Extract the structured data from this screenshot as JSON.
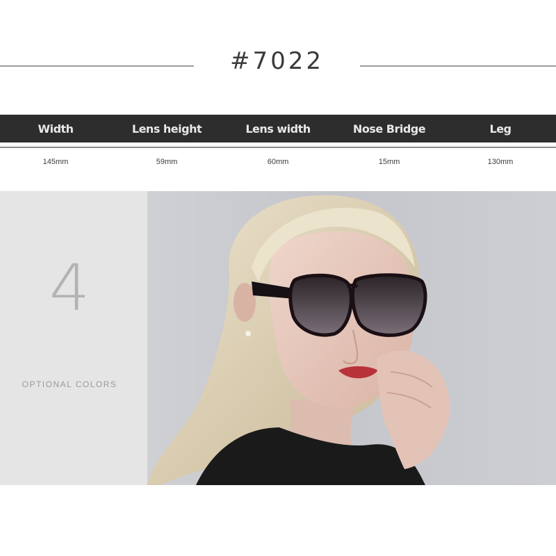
{
  "model": {
    "title": "#7022"
  },
  "specs": {
    "headers": [
      "Width",
      "Lens height",
      "Lens width",
      "Nose Bridge",
      "Leg"
    ],
    "values": [
      "145mm",
      "59mm",
      "60mm",
      "15mm",
      "130mm"
    ]
  },
  "colors": {
    "count": "4",
    "caption": "OPTIONAL COLORS"
  },
  "palette": {
    "header_bg": "#2d2d2d",
    "panel_bg": "#e5e5e5",
    "photo_bg": "#c8c9cd"
  }
}
